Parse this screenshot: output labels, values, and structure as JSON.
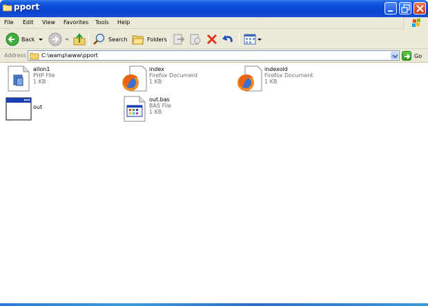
{
  "window": {
    "title": "pport",
    "accent_color": "#0a46d2"
  },
  "menu": {
    "items": [
      "File",
      "Edit",
      "View",
      "Favorites",
      "Tools",
      "Help"
    ]
  },
  "toolbar": {
    "back_label": "Back",
    "search_label": "Search",
    "folders_label": "Folders"
  },
  "address": {
    "label": "Address",
    "value": "C:\\wamp\\www\\pport",
    "go_label": "Go"
  },
  "files": [
    {
      "name": "allon1",
      "type": "PHP File",
      "size": "1 KB",
      "icon": "php-file-icon"
    },
    {
      "name": "index",
      "type": "Firefox Document",
      "size": "1 KB",
      "icon": "firefox-document-icon"
    },
    {
      "name": "indexold",
      "type": "Firefox Document",
      "size": "1 KB",
      "icon": "firefox-document-icon"
    },
    {
      "name": "out",
      "type": "",
      "size": "",
      "icon": "application-window-icon"
    },
    {
      "name": "out.bas",
      "type": "BAS File",
      "size": "1 KB",
      "icon": "bas-file-icon"
    }
  ]
}
